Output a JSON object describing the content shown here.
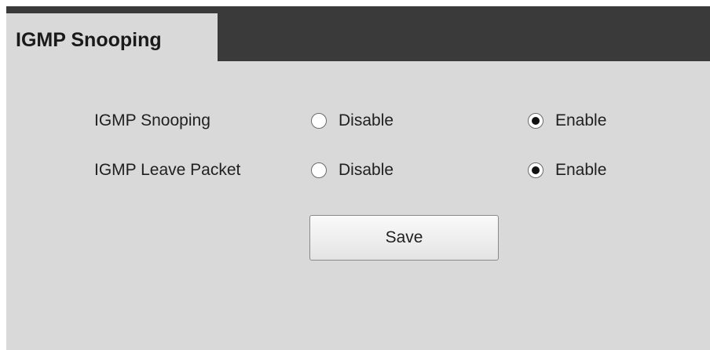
{
  "tab": {
    "title": "IGMP Snooping"
  },
  "settings": [
    {
      "label": "IGMP Snooping",
      "options": [
        {
          "label": "Disable",
          "checked": false
        },
        {
          "label": "Enable",
          "checked": true
        }
      ]
    },
    {
      "label": "IGMP Leave Packet",
      "options": [
        {
          "label": "Disable",
          "checked": false
        },
        {
          "label": "Enable",
          "checked": true
        }
      ]
    }
  ],
  "actions": {
    "save_label": "Save"
  }
}
